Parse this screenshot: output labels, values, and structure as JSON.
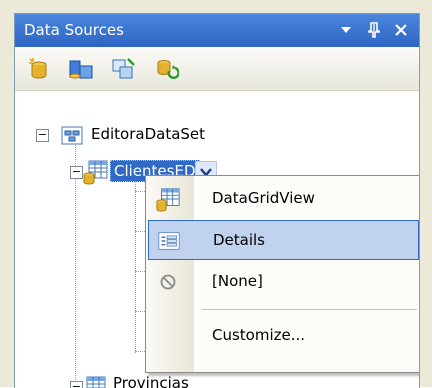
{
  "panel": {
    "title": "Data Sources",
    "buttons": {
      "dropdown_glyph": "▾",
      "pin_glyph": "ᕁ",
      "close_glyph": "✕"
    }
  },
  "toolbar": {
    "icons": [
      "add-new-data-source-icon",
      "edit-dataset-designer-icon",
      "configure-dataset-wizard-icon",
      "refresh-icon"
    ]
  },
  "tree": {
    "root": {
      "label": "EditoraDataSet",
      "expander": "−"
    },
    "child_selected": {
      "label": "ClientesED",
      "expander": "−"
    },
    "child_partial": {
      "label": "Provincias",
      "expander": "−"
    }
  },
  "context_menu": {
    "items": [
      {
        "label": "DataGridView",
        "icon": "datagridview-icon",
        "highlighted": false
      },
      {
        "label": "Details",
        "icon": "details-icon",
        "highlighted": true
      },
      {
        "label": "[None]",
        "icon": "none-icon",
        "highlighted": false
      },
      {
        "label": "Customize...",
        "icon": "",
        "highlighted": false
      }
    ]
  },
  "colors": {
    "titlebar": "#2e64c4",
    "selection": "#316ac5",
    "menu_highlight": "#c1d2ee"
  }
}
